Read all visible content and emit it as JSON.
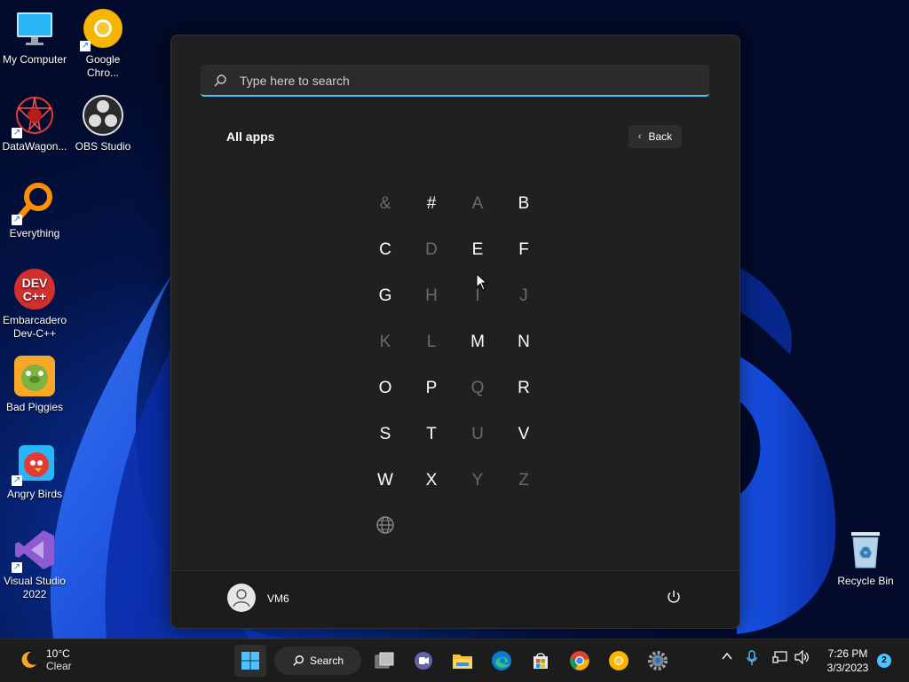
{
  "desktop": {
    "icons": [
      {
        "label": "My Computer",
        "icon": "monitor-icon"
      },
      {
        "label": "Google Chro...",
        "icon": "chrome-canary-icon"
      },
      {
        "label": "DataWagon...",
        "icon": "datawagon-icon"
      },
      {
        "label": "OBS Studio",
        "icon": "obs-icon"
      },
      {
        "label": "Everything",
        "icon": "everything-search-icon"
      },
      {
        "label": "Embarcadero Dev-C++",
        "icon": "devcpp-icon"
      },
      {
        "label": "Bad Piggies",
        "icon": "bad-piggies-icon"
      },
      {
        "label": "Angry Birds",
        "icon": "angry-birds-icon"
      },
      {
        "label": "Visual Studio 2022",
        "icon": "visual-studio-icon"
      },
      {
        "label": "Recycle Bin",
        "icon": "recycle-bin-icon"
      }
    ]
  },
  "start_menu": {
    "search_placeholder": "Type here to search",
    "title": "All apps",
    "back_label": "Back",
    "letters": [
      {
        "char": "&",
        "enabled": false
      },
      {
        "char": "#",
        "enabled": true
      },
      {
        "char": "A",
        "enabled": false
      },
      {
        "char": "B",
        "enabled": true
      },
      {
        "char": "C",
        "enabled": true
      },
      {
        "char": "D",
        "enabled": false
      },
      {
        "char": "E",
        "enabled": true
      },
      {
        "char": "F",
        "enabled": true
      },
      {
        "char": "G",
        "enabled": true
      },
      {
        "char": "H",
        "enabled": false
      },
      {
        "char": "I",
        "enabled": false
      },
      {
        "char": "J",
        "enabled": false
      },
      {
        "char": "K",
        "enabled": false
      },
      {
        "char": "L",
        "enabled": false
      },
      {
        "char": "M",
        "enabled": true
      },
      {
        "char": "N",
        "enabled": true
      },
      {
        "char": "O",
        "enabled": true
      },
      {
        "char": "P",
        "enabled": true
      },
      {
        "char": "Q",
        "enabled": false
      },
      {
        "char": "R",
        "enabled": true
      },
      {
        "char": "S",
        "enabled": true
      },
      {
        "char": "T",
        "enabled": true
      },
      {
        "char": "U",
        "enabled": false
      },
      {
        "char": "V",
        "enabled": true
      },
      {
        "char": "W",
        "enabled": true
      },
      {
        "char": "X",
        "enabled": true
      },
      {
        "char": "Y",
        "enabled": false
      },
      {
        "char": "Z",
        "enabled": false
      }
    ],
    "globe_icon": "globe-icon",
    "user_name": "VM6",
    "power_icon": "power-icon"
  },
  "taskbar": {
    "weather_temp": "10°C",
    "weather_desc": "Clear",
    "search_label": "Search",
    "apps": [
      "start-icon",
      "task-view-icon",
      "teams-chat-icon",
      "file-explorer-icon",
      "edge-icon",
      "store-icon",
      "chrome-icon",
      "chrome-canary-icon",
      "settings-icon"
    ],
    "time": "7:26 PM",
    "date": "3/3/2023",
    "notification_count": "2"
  },
  "colors": {
    "accent": "#4cc2ff",
    "menu_bg": "#202020",
    "taskbar_bg": "#1c1c1c",
    "disabled_letter": "#6b6b6b"
  }
}
